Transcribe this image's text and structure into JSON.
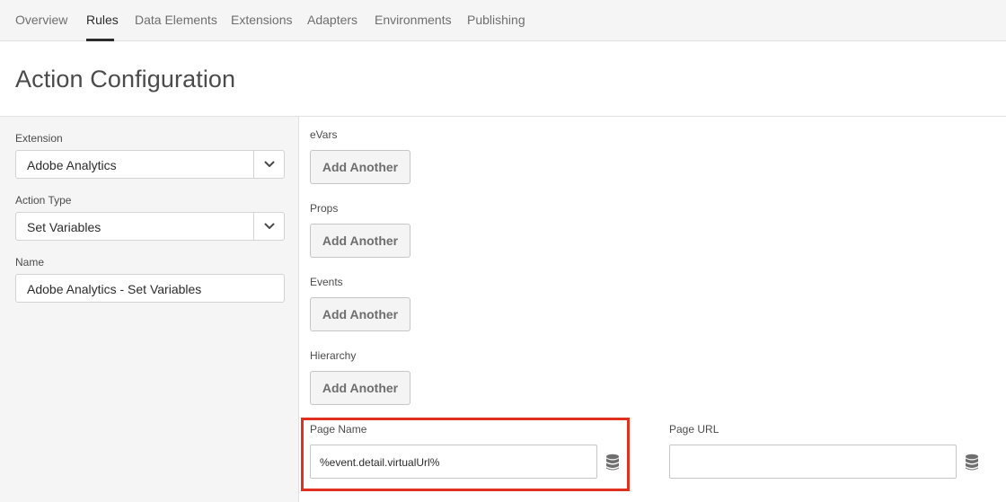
{
  "nav": {
    "tabs": [
      {
        "label": "Overview"
      },
      {
        "label": "Rules"
      },
      {
        "label": "Data Elements"
      },
      {
        "label": "Extensions"
      },
      {
        "label": "Adapters"
      },
      {
        "label": "Environments"
      },
      {
        "label": "Publishing"
      }
    ],
    "active": "Rules"
  },
  "page": {
    "title": "Action Configuration"
  },
  "left": {
    "extension": {
      "label": "Extension",
      "value": "Adobe Analytics"
    },
    "action_type": {
      "label": "Action Type",
      "value": "Set Variables"
    },
    "name": {
      "label": "Name",
      "value": "Adobe Analytics - Set Variables"
    }
  },
  "main": {
    "sections": [
      {
        "label": "eVars",
        "button": "Add Another"
      },
      {
        "label": "Props",
        "button": "Add Another"
      },
      {
        "label": "Events",
        "button": "Add Another"
      },
      {
        "label": "Hierarchy",
        "button": "Add Another"
      }
    ],
    "page_name": {
      "label": "Page Name",
      "value": "%event.detail.virtualUrl%"
    },
    "page_url": {
      "label": "Page URL",
      "value": ""
    }
  },
  "colors": {
    "highlight": "#e0301e",
    "nav_bg": "#f5f5f5",
    "button_bg": "#f4f4f4"
  },
  "icons": {
    "dropdown": "chevron-down-icon",
    "data_element": "database-icon"
  }
}
